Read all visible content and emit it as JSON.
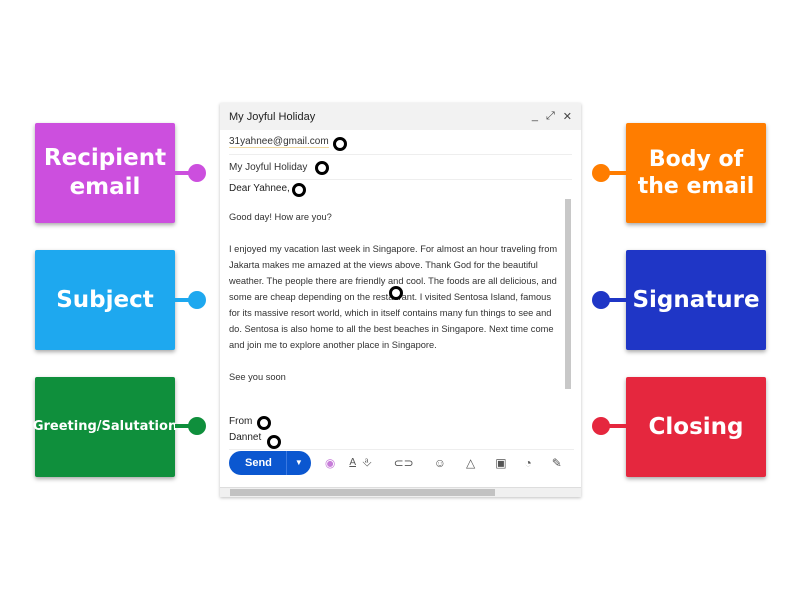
{
  "labels": {
    "recipient": {
      "text": "Recipient email",
      "color": "#cc4fde"
    },
    "subject": {
      "text": "Subject",
      "color": "#1ea8ef"
    },
    "greeting": {
      "text": "Greeting/Salutation",
      "color": "#0f8f3c"
    },
    "body": {
      "text": "Body of the email",
      "color": "#ff7d00"
    },
    "signature": {
      "text": "Signature",
      "color": "#1f36c6"
    },
    "closing": {
      "text": "Closing",
      "color": "#e5273e"
    }
  },
  "email": {
    "window_title": "My Joyful Holiday",
    "to": "31yahnee@gmail.com",
    "subject": "My Joyful Holiday",
    "greeting": "Dear Yahnee,",
    "opening": "Good day! How are you?",
    "body": "I enjoyed my vacation last week in Singapore. For almost an hour traveling from Jakarta makes me amazed at the views above. Thank God for the beautiful weather. The people there are friendly and cool. The foods are all delicious, and some are cheap depending on the restaurant. I visited Sentosa Island,  famous for its massive resort world, which in itself contains many fun things to see and do. Sentosa is also home to all the best beaches in Singapore. Next time come and join me to explore another place in Singapore.",
    "closing_line": "See you soon",
    "closing": "From",
    "signature": "Dannet",
    "send_label": "Send"
  }
}
